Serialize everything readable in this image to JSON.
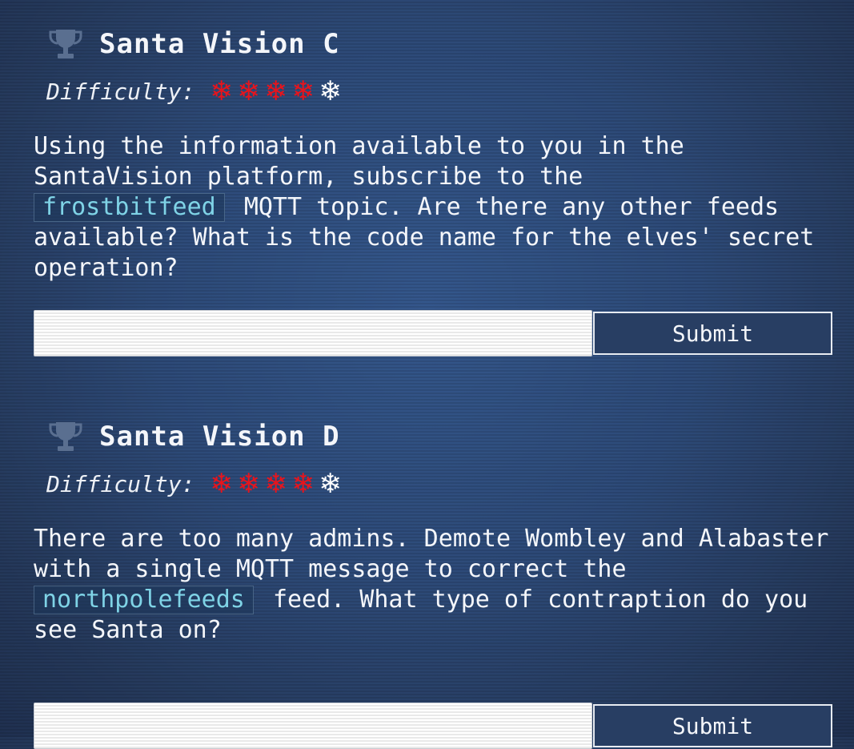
{
  "challenges": [
    {
      "title": "Santa Vision C",
      "difficulty_label": "Difficulty:",
      "difficulty_filled": 4,
      "difficulty_total": 5,
      "description_before": "Using the information available to you in the SantaVision platform, subscribe to the",
      "code": "frostbitfeed",
      "description_after": "MQTT topic. Are there any other feeds available? What is the code name for the elves' secret operation?",
      "answer_value": "",
      "submit_label": "Submit"
    },
    {
      "title": "Santa Vision D",
      "difficulty_label": "Difficulty:",
      "difficulty_filled": 4,
      "difficulty_total": 5,
      "description_before": "There are too many admins. Demote Wombley and Alabaster with a single MQTT message to correct the",
      "code": "northpolefeeds",
      "description_after": "feed. What type of contraption do you see Santa on?",
      "answer_value": "",
      "submit_label": "Submit"
    }
  ],
  "icons": {
    "trophy": "trophy-icon",
    "difficulty_filled": "snowflake-red-icon",
    "difficulty_empty": "snowflake-white-icon"
  },
  "colors": {
    "background": "#2c4670",
    "text": "#f4f6fa",
    "code_text": "#7fd3e6",
    "flake_filled": "#e8141c",
    "flake_empty": "#ffffff",
    "trophy": "#5a6f90"
  }
}
